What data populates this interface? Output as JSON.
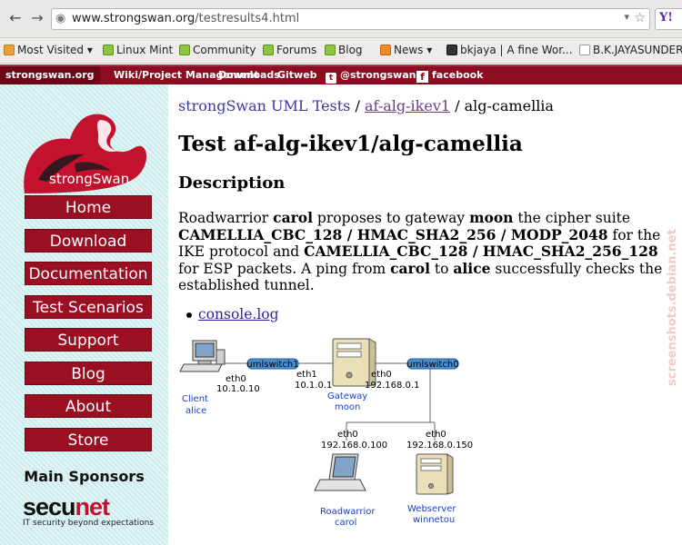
{
  "browser": {
    "back_icon": "arrow-left-icon",
    "forward_icon": "arrow-right-icon",
    "url_host": "www.strongswan.org",
    "url_path": "/testresults4.html",
    "bookmarks": [
      {
        "label": "Most Visited ▾",
        "icon": "folder-icon"
      },
      {
        "label": "Linux Mint",
        "icon": "mint-icon"
      },
      {
        "label": "Community",
        "icon": "mint-icon"
      },
      {
        "label": "Forums",
        "icon": "mint-icon"
      },
      {
        "label": "Blog",
        "icon": "mint-icon"
      },
      {
        "label": "News ▾",
        "icon": "rss-icon"
      },
      {
        "label": "bkjaya | A fine Wor...",
        "icon": "film-icon"
      },
      {
        "label": "B.K.JAYASUNDER...",
        "icon": "page-icon"
      }
    ]
  },
  "topnav": {
    "home": "strongswan.org",
    "wiki": "Wiki/Project Management",
    "downloads": "Downloads",
    "gitweb": "Gitweb",
    "twitter": "@strongswan",
    "facebook": "facebook"
  },
  "sidebar": {
    "logo_text": "strongSwan",
    "menu": [
      "Home",
      "Download",
      "Documentation",
      "Test Scenarios",
      "Support",
      "Blog",
      "About",
      "Store"
    ],
    "sponsors_title": "Main Sponsors",
    "sponsor_name_a": "secu",
    "sponsor_name_b": "net",
    "sponsor_tagline": "IT security beyond expectations"
  },
  "main": {
    "breadcrumb": {
      "item1": "strongSwan UML Tests",
      "sep1": " / ",
      "item2": "af-alg-ikev1",
      "sep2": " / ",
      "item3": "alg-camellia"
    },
    "title": "Test af-alg-ikev1/alg-camellia",
    "description_heading": "Description",
    "description": {
      "t1": "Roadwarrior ",
      "b1": "carol",
      "t2": " proposes to gateway ",
      "b2": "moon",
      "t3": " the cipher suite ",
      "b3": "CAMELLIA_CBC_128 / HMAC_SHA2_256 / MODP_2048",
      "t4": " for the IKE protocol and ",
      "b4": "CAMELLIA_CBC_128 / HMAC_SHA2_256_128",
      "t5": " for ESP packets. A ping from ",
      "b5": "carol",
      "t6": " to ",
      "b6": "alice",
      "t7": " successfully checks the established tunnel."
    },
    "links": [
      "console.log"
    ]
  },
  "diagram": {
    "switch1": "umlswitch1",
    "switch0": "umlswitch0",
    "alice_iface": "eth0",
    "alice_ip": "10.1.0.10",
    "alice_name1": "Client",
    "alice_name2": "alice",
    "moon_iface1": "eth1",
    "moon_ip1": "10.1.0.1",
    "moon_iface0": "eth0",
    "moon_ip0": "192.168.0.1",
    "moon_name1": "Gateway",
    "moon_name2": "moon",
    "carol_iface": "eth0",
    "carol_ip": "192.168.0.100",
    "carol_name1": "Roadwarrior",
    "carol_name2": "carol",
    "winnetou_iface": "eth0",
    "winnetou_ip": "192.168.0.150",
    "winnetou_name1": "Webserver",
    "winnetou_name2": "winnetou"
  },
  "watermark": "screenshots.debian.net"
}
